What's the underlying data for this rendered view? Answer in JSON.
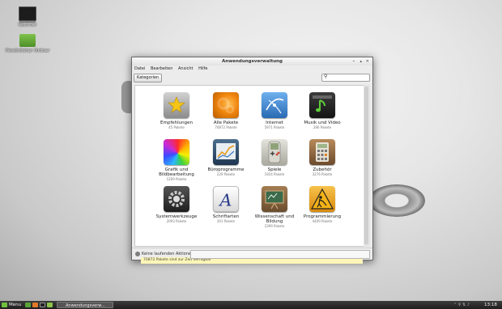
{
  "desktop": {
    "icons": [
      {
        "label": "Rechner"
      },
      {
        "label": "Persönlicher Ordner"
      }
    ]
  },
  "window": {
    "title": "Anwendungsverwaltung",
    "menu": [
      "Datei",
      "Bearbeiten",
      "Ansicht",
      "Hilfe"
    ],
    "toolbar": {
      "kategorien_label": "Kategorien",
      "search_value": ""
    },
    "categories": [
      {
        "name": "Empfehlungen",
        "count": "45 Pakete",
        "icon": "star-gears-icon",
        "color": "#a8a8a8"
      },
      {
        "name": "Alle Pakete",
        "count": "70872 Pakete",
        "icon": "orange-gears-icon",
        "color": "#e8820e"
      },
      {
        "name": "Internet",
        "count": "5971 Pakete",
        "icon": "globe-icon",
        "color": "#3f8dd6"
      },
      {
        "name": "Musik und Video",
        "count": "286 Pakete",
        "icon": "music-note-icon",
        "color": "#2a2a2a"
      },
      {
        "name": "Grafik und Bildbearbeitung",
        "count": "1269 Pakete",
        "icon": "color-wheel-icon",
        "color": "#d83ad0"
      },
      {
        "name": "Büroprogramme",
        "count": "229 Pakete",
        "icon": "chart-icon",
        "color": "#2f4f6f"
      },
      {
        "name": "Spiele",
        "count": "1924 Pakete",
        "icon": "gamepad-icon",
        "color": "#c9c9c2"
      },
      {
        "name": "Zubehör",
        "count": "3276 Pakete",
        "icon": "calculator-icon",
        "color": "#7b5a3c"
      },
      {
        "name": "Systemwerkzeuge",
        "count": "2093 Pakete",
        "icon": "gear-icon",
        "color": "#3a3a3a"
      },
      {
        "name": "Schriftarten",
        "count": "301 Pakete",
        "icon": "font-icon",
        "color": "#f2f2f2"
      },
      {
        "name": "Wissenschaft und Bildung",
        "count": "2399 Pakete",
        "icon": "chalkboard-icon",
        "color": "#8a6a44"
      },
      {
        "name": "Programmierung",
        "count": "4409 Pakete",
        "icon": "construction-icon",
        "color": "#f0a81c"
      }
    ],
    "status": "70872 Pakete sind zur Zeit verfügbar",
    "bottom": {
      "label": "Keine laufenden Aktionen"
    }
  },
  "taskbar": {
    "menu_label": "Menu",
    "task_label": "Anwendungsverw...",
    "clock": "13:18"
  }
}
